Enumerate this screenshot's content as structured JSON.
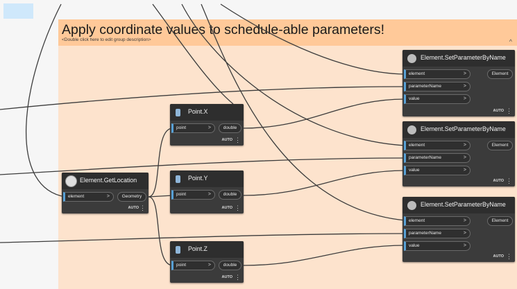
{
  "group": {
    "title": "Apply coordinate values to schedule-able parameters!",
    "description": "<Double click here to edit group description>",
    "collapse_glyph": "^",
    "header_color": "#ffc999",
    "body_color": "#fde3cd"
  },
  "nodes": {
    "get_location": {
      "title": "Element.GetLocation",
      "icon": "location-icon",
      "inputs": [
        "element"
      ],
      "output": "Geometry",
      "lacing": "AUTO"
    },
    "point_x": {
      "title": "Point.X",
      "icon": "property-icon",
      "input": "point",
      "output": "double",
      "lacing": "AUTO"
    },
    "point_y": {
      "title": "Point.Y",
      "icon": "property-icon",
      "input": "point",
      "output": "double",
      "lacing": "AUTO"
    },
    "point_z": {
      "title": "Point.Z",
      "icon": "property-icon",
      "input": "point",
      "output": "double",
      "lacing": "AUTO"
    },
    "set_param_1": {
      "title": "Element.SetParameterByName",
      "icon": "method-icon",
      "inputs": [
        "element",
        "parameterName",
        "value"
      ],
      "output": "Element",
      "lacing": "AUTO"
    },
    "set_param_2": {
      "title": "Element.SetParameterByName",
      "icon": "method-icon",
      "inputs": [
        "element",
        "parameterName",
        "value"
      ],
      "output": "Element",
      "lacing": "AUTO"
    },
    "set_param_3": {
      "title": "Element.SetParameterByName",
      "icon": "method-icon",
      "inputs": [
        "element",
        "parameterName",
        "value"
      ],
      "output": "Element",
      "lacing": "AUTO"
    }
  },
  "port_arrow": ">",
  "menu_glyph": "⋮",
  "wire_color": "#3c3c3c",
  "port_accent": "#57a0d5"
}
